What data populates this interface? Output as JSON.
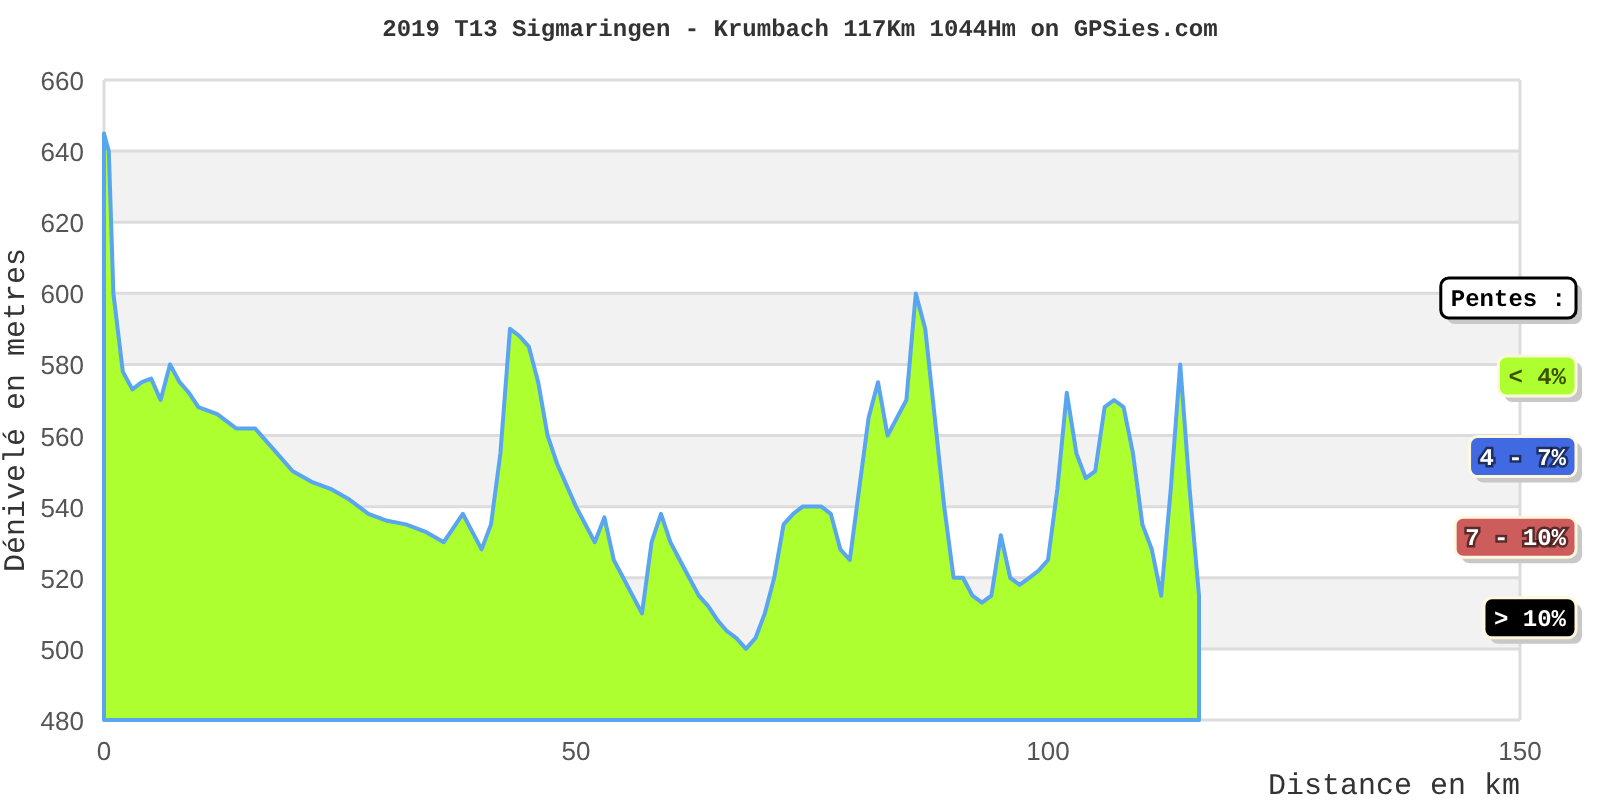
{
  "chart_data": {
    "type": "area",
    "title": "2019 T13 Sigmaringen - Krumbach 117Km 1044Hm on GPSies.com",
    "xlabel": "Distance en km",
    "ylabel": "Dénivelé en metres",
    "x": [
      0,
      0.5,
      1,
      2,
      3,
      4,
      5,
      6,
      7,
      8,
      9,
      10,
      12,
      14,
      16,
      18,
      20,
      22,
      24,
      26,
      28,
      30,
      32,
      34,
      36,
      38,
      40,
      41,
      42,
      43,
      44,
      45,
      46,
      47,
      48,
      50,
      52,
      53,
      54,
      55,
      56,
      57,
      58,
      59,
      60,
      61,
      62,
      63,
      64,
      65,
      66,
      67,
      68,
      69,
      70,
      71,
      72,
      73,
      74,
      75,
      76,
      77,
      78,
      79,
      80,
      81,
      82,
      83,
      84,
      85,
      86,
      87,
      88,
      89,
      90,
      91,
      92,
      93,
      94,
      95,
      96,
      97,
      98,
      99,
      100,
      101,
      102,
      103,
      104,
      105,
      106,
      107,
      108,
      109,
      110,
      111,
      112,
      113,
      114,
      115,
      116
    ],
    "grid": true,
    "series": [
      {
        "color": "#adff2f",
        "values": [
          645,
          640,
          600,
          578,
          573,
          575,
          576,
          570,
          580,
          575,
          572,
          568,
          566,
          562,
          562,
          556,
          550,
          547,
          545,
          542,
          538,
          536,
          535,
          533,
          530,
          538,
          528,
          535,
          555,
          590,
          588,
          585,
          575,
          560,
          552,
          540,
          530,
          537,
          525,
          520,
          515,
          510,
          530,
          538,
          530,
          525,
          520,
          515,
          512,
          508,
          505,
          503,
          500,
          503,
          510,
          520,
          535,
          538,
          540,
          540,
          540,
          538,
          528,
          525,
          545,
          565,
          575,
          560,
          565,
          570,
          600,
          590,
          565,
          540,
          520,
          520,
          515,
          513,
          515,
          532,
          520,
          518,
          520,
          522,
          525,
          545,
          572,
          555,
          548,
          550,
          568,
          570,
          568,
          555,
          535,
          528,
          515,
          545,
          580,
          545,
          515
        ]
      }
    ],
    "xlim": [
      0,
      150
    ],
    "ylim": [
      480,
      660
    ],
    "xticks": [
      0,
      50,
      100,
      150
    ],
    "yticks": [
      480,
      500,
      520,
      540,
      560,
      580,
      600,
      620,
      640,
      660
    ]
  },
  "legend": {
    "title": "Pentes :",
    "items": [
      {
        "label": "< 4%",
        "color": "#adff2f"
      },
      {
        "label": "4 - 7%",
        "color": "#4169e1"
      },
      {
        "label": "7 - 10%",
        "color": "#cd5c5c"
      },
      {
        "label": "> 10%",
        "color": "#000000"
      }
    ]
  }
}
